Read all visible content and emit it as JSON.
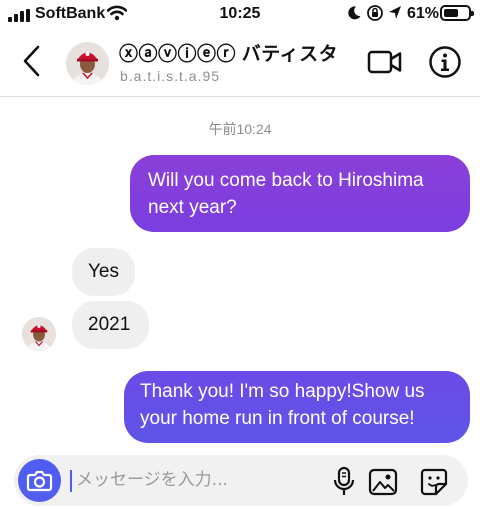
{
  "status_bar": {
    "carrier": "SoftBank",
    "time": "10:25",
    "battery_percent": "61%",
    "battery_level": 0.61,
    "icons": [
      "cellular-signal-icon",
      "wifi-icon",
      "moon-icon",
      "orientation-lock-icon",
      "location-icon",
      "battery-icon"
    ]
  },
  "header": {
    "back_icon": "chevron-left-icon",
    "name": "ⓧⓐⓥⓘⓔⓡ バティスタ",
    "username": "b.a.t.i.s.t.a.95",
    "actions": [
      "video-call-icon",
      "info-icon"
    ]
  },
  "conversation": {
    "timestamp": "午前10:24",
    "messages": [
      {
        "direction": "outgoing",
        "text": "Will you come back to Hiroshima next year?"
      },
      {
        "direction": "incoming",
        "text": "Yes"
      },
      {
        "direction": "incoming",
        "text": "2021"
      },
      {
        "direction": "outgoing",
        "text": "Thank you! I'm so happy!Show us your home run in front of course!"
      }
    ]
  },
  "composer": {
    "placeholder": "メッセージを入力...",
    "value": "",
    "icons": [
      "camera-icon",
      "microphone-icon",
      "gallery-icon",
      "sticker-icon"
    ]
  },
  "colors": {
    "outgoing_top": "#8a3fd8",
    "outgoing_bottom": "#5e55e8",
    "incoming": "#efefef",
    "accent": "#4f5ef0"
  }
}
